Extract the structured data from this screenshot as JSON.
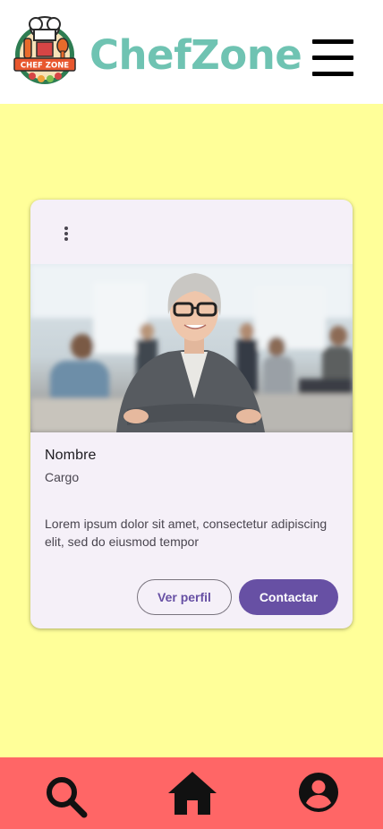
{
  "app": {
    "brand_name": "ChefZone",
    "logo_text": "CHEF ZONE"
  },
  "colors": {
    "page_background": "#ffff99",
    "header_background": "#ffffff",
    "brand_text": "#6fc3b2",
    "card_background": "#f5f0f8",
    "primary": "#6750a4",
    "bottom_nav_background": "#ff6666"
  },
  "header": {
    "logo_icon": "chef-zone-logo",
    "menu_icon": "hamburger-menu-icon"
  },
  "card": {
    "more_icon": "more-vertical-icon",
    "image_alt": "profile-photo",
    "name": "Nombre",
    "role": "Cargo",
    "description": "Lorem ipsum dolor sit amet, consectetur adipiscing elit, sed do eiusmod tempor",
    "secondary_button": "Ver perfil",
    "primary_button": "Contactar"
  },
  "bottom_nav": {
    "items": [
      {
        "icon": "search-icon"
      },
      {
        "icon": "home-icon"
      },
      {
        "icon": "account-icon"
      }
    ]
  }
}
